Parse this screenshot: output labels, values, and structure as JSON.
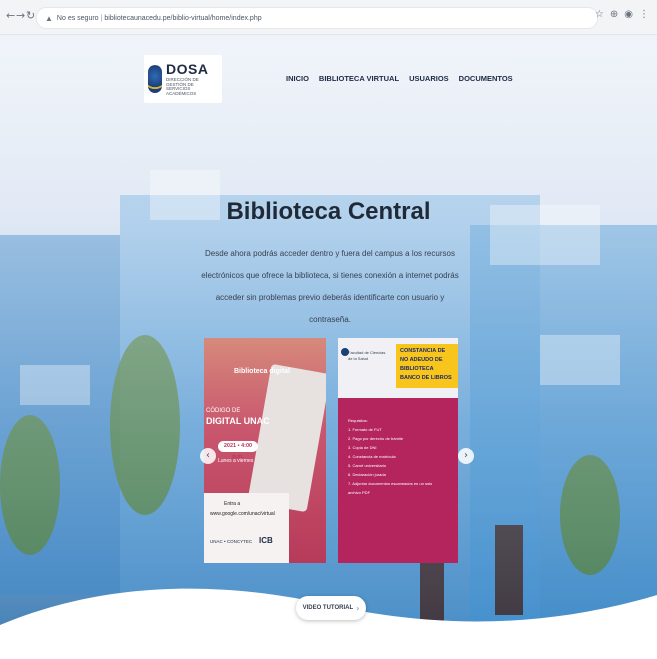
{
  "browser": {
    "back_icon": "arrow-left-icon",
    "forward_icon": "arrow-right-icon",
    "reload_icon": "reload-icon",
    "security_label": "No es seguro",
    "url": "bibliotecaunacedu.pe/biblio-virtual/home/index.php",
    "right_icons": [
      "bookmark-icon",
      "extension-icon",
      "profile-icon",
      "menu-icon"
    ]
  },
  "header": {
    "logo_title": "DOSA",
    "logo_subtitle": "DIRECCIÓN DE GESTIÓN DE SERVICIOS ACADÉMICOS",
    "nav": [
      "INICIO",
      "BIBLIOTECA VIRTUAL",
      "USUARIOS",
      "DOCUMENTOS"
    ]
  },
  "main": {
    "title": "Biblioteca Central",
    "intro": "Desde ahora podrás acceder dentro y fuera del campus a los recursos electrónicos que ofrece la biblioteca, si tienes conexión a internet podrás acceder sin problemas previo deberás identificarte con usuario y contraseña."
  },
  "carousel": {
    "slide1": {
      "tag_top": "Biblioteca digital",
      "tag_line1": "CÓDIGO DE",
      "tag_line2": "DIGITAL UNAC",
      "pill": "2021 • 4:00 p.m.",
      "small": "Lunes a viernes",
      "footer_line1": "Entra a",
      "footer_line2": "www.google.com/unac/virtual",
      "footer_brand": "ICB",
      "footer_partner": "UNAC • CONCYTEC"
    },
    "slide2": {
      "org": "Facultad de Ciencias de la Salud",
      "banner": "CONSTANCIA DE NO ADEUDO DE BIBLIOTECA BANCO DE LIBROS",
      "requirements": [
        "Requisitos:",
        "1. Formato de FUT",
        "2. Pago por derecho de trámite",
        "3. Copia de DNI",
        "4. Constancia de matrícula",
        "5. Carné universitario",
        "6. Declaración jurada",
        "7. Adjuntar documentos escaneados en un solo archivo PDF"
      ]
    }
  },
  "video_button": {
    "label": "VIDEO TUTORIAL",
    "icon": "chevron-right-icon"
  },
  "colors": {
    "accent": "#b3255c",
    "brand_navy": "#1f2a44",
    "banner_yellow": "#f7c51b"
  }
}
